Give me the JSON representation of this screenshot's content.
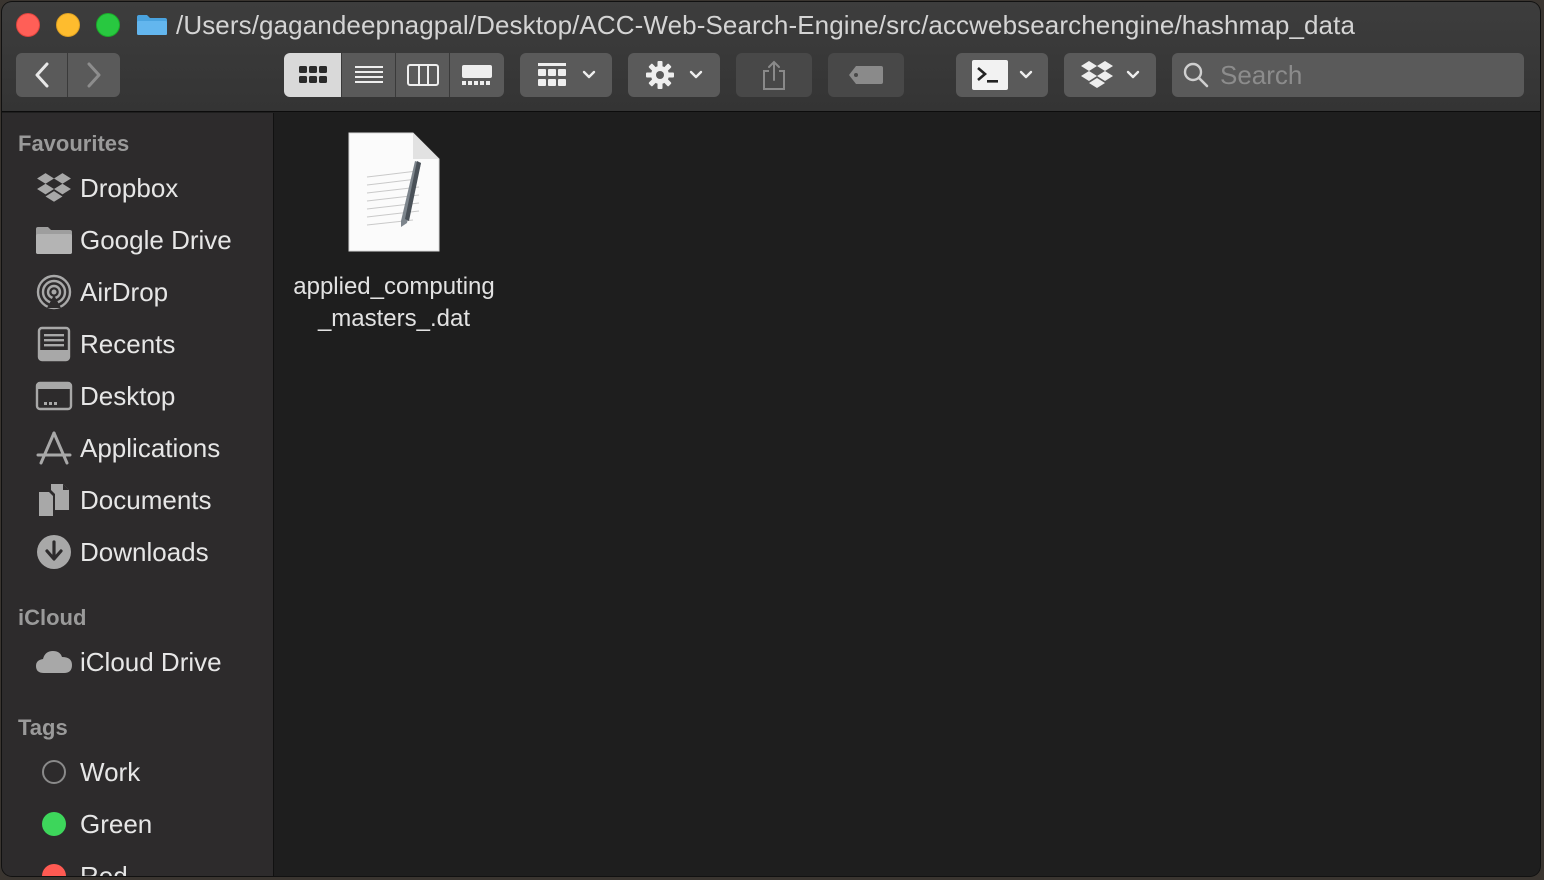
{
  "window": {
    "path": "/Users/gagandeepnagpal/Desktop/ACC-Web-Search-Engine/src/accwebsearchengine/hashmap_data"
  },
  "toolbar": {
    "search_placeholder": "Search",
    "view_modes": [
      "icon-view",
      "list-view",
      "column-view",
      "gallery-view"
    ],
    "active_view": "icon-view"
  },
  "sidebar": {
    "favourites_header": "Favourites",
    "favourites": [
      {
        "label": "Dropbox",
        "icon": "dropbox-icon"
      },
      {
        "label": "Google Drive",
        "icon": "folder-icon"
      },
      {
        "label": "AirDrop",
        "icon": "airdrop-icon"
      },
      {
        "label": "Recents",
        "icon": "recents-icon"
      },
      {
        "label": "Desktop",
        "icon": "desktop-icon"
      },
      {
        "label": "Applications",
        "icon": "applications-icon"
      },
      {
        "label": "Documents",
        "icon": "documents-icon"
      },
      {
        "label": "Downloads",
        "icon": "downloads-icon"
      }
    ],
    "icloud_header": "iCloud",
    "icloud": [
      {
        "label": "iCloud Drive",
        "icon": "cloud-icon"
      }
    ],
    "tags_header": "Tags",
    "tags": [
      {
        "label": "Work",
        "color": "#00000000"
      },
      {
        "label": "Green",
        "color": "#3dd65b"
      },
      {
        "label": "Red",
        "color": "#ff5a52"
      }
    ]
  },
  "files": [
    {
      "name": "applied_computing_masters_.dat",
      "icon": "text-document-icon"
    }
  ]
}
